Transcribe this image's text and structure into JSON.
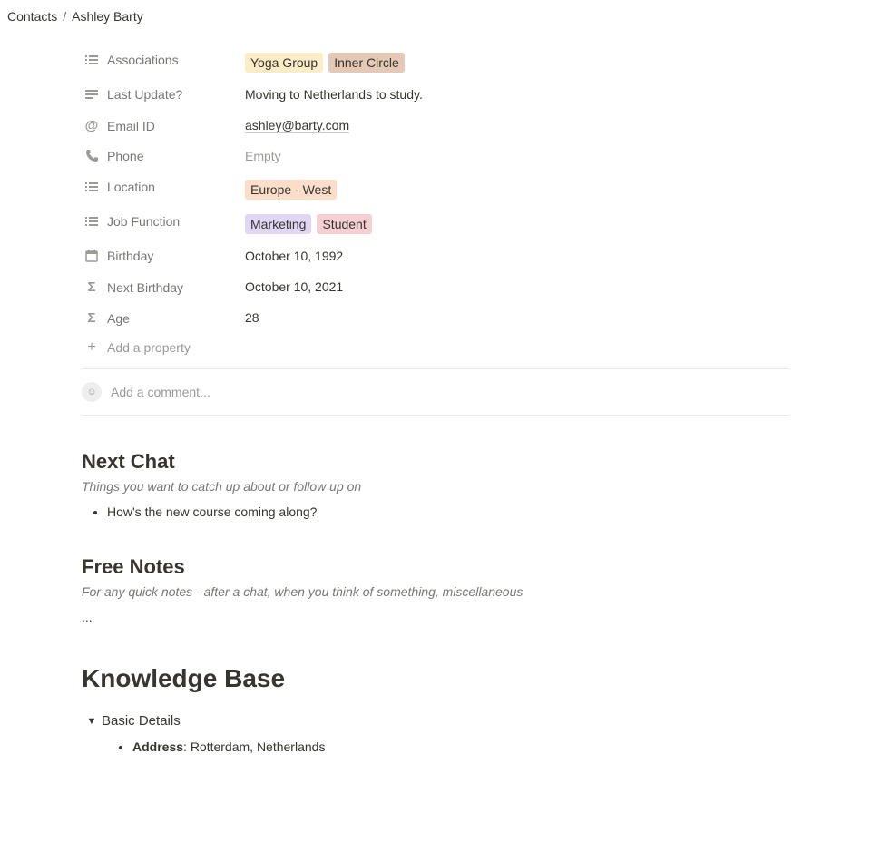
{
  "breadcrumb": {
    "root": "Contacts",
    "current": "Ashley Barty"
  },
  "properties": {
    "associations": {
      "label": "Associations",
      "tags": [
        {
          "text": "Yoga Group",
          "cls": "tag-yellow"
        },
        {
          "text": "Inner Circle",
          "cls": "tag-brown"
        }
      ]
    },
    "last_update": {
      "label": "Last Update?",
      "value": "Moving to Netherlands to study."
    },
    "email": {
      "label": "Email ID",
      "value": "ashley@barty.com"
    },
    "phone": {
      "label": "Phone",
      "value": "Empty"
    },
    "location": {
      "label": "Location",
      "tags": [
        {
          "text": "Europe - West",
          "cls": "tag-orange"
        }
      ]
    },
    "job_function": {
      "label": "Job Function",
      "tags": [
        {
          "text": "Marketing",
          "cls": "tag-purple"
        },
        {
          "text": "Student",
          "cls": "tag-pink"
        }
      ]
    },
    "birthday": {
      "label": "Birthday",
      "value": "October 10, 1992"
    },
    "next_birthday": {
      "label": "Next Birthday",
      "value": "October 10, 2021"
    },
    "age": {
      "label": "Age",
      "value": "28"
    }
  },
  "add_property_label": "Add a property",
  "comment_placeholder": "Add a comment...",
  "sections": {
    "next_chat": {
      "title": "Next Chat",
      "subtitle": "Things you want to catch up about or follow up on",
      "items": [
        "How's the new course coming along?"
      ]
    },
    "free_notes": {
      "title": "Free Notes",
      "subtitle": "For any quick notes - after a chat, when you think of something, miscellaneous",
      "body": "..."
    },
    "knowledge_base": {
      "title": "Knowledge Base",
      "toggle_label": "Basic Details",
      "items": [
        {
          "label": "Address",
          "value": "Rotterdam, Netherlands"
        }
      ]
    }
  }
}
